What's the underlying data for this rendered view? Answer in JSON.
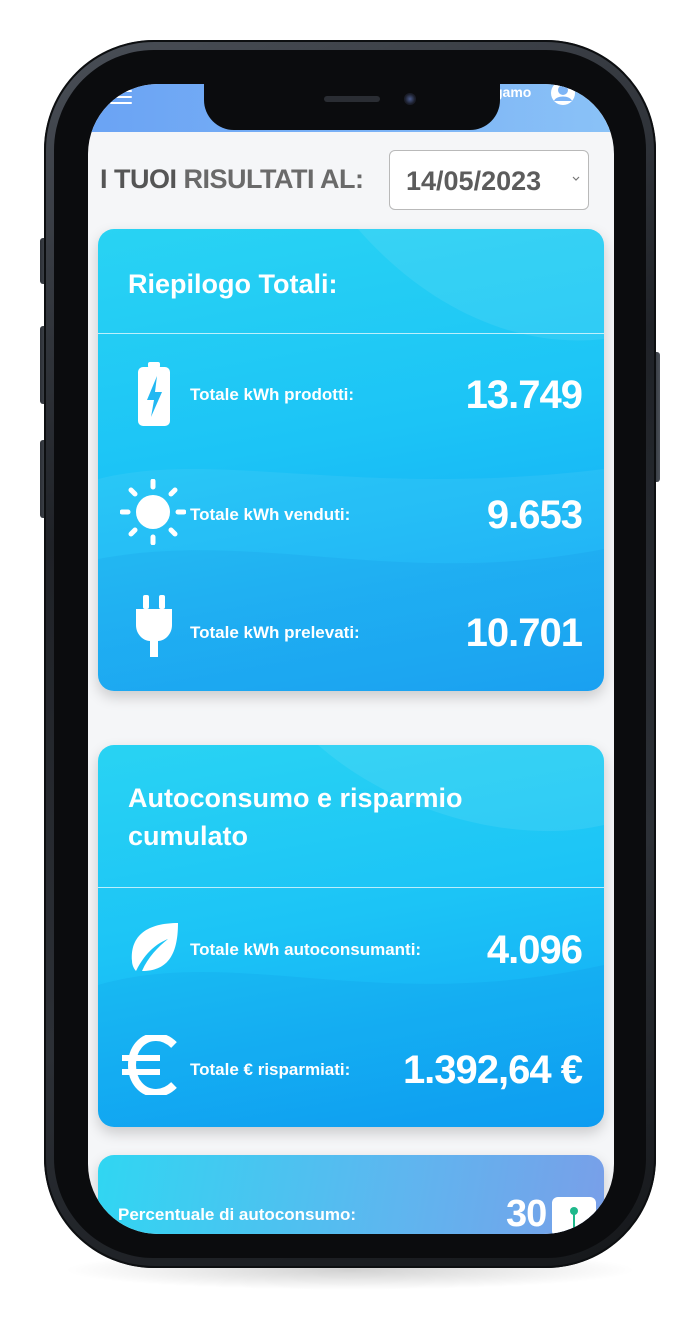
{
  "header": {
    "user_text": "gamo"
  },
  "results": {
    "title_part1": "I TUOI",
    "title_part2": "RISULTATI AL:",
    "date_value": "14/05/2023"
  },
  "summary_card": {
    "title": "Riepilogo Totali:",
    "rows": [
      {
        "icon": "battery-icon",
        "label": "Totale kWh prodotti:",
        "value": "13.749"
      },
      {
        "icon": "sun-icon",
        "label": "Totale kWh venduti:",
        "value": "9.653"
      },
      {
        "icon": "plug-icon",
        "label": "Totale kWh prelevati:",
        "value": "10.701"
      }
    ]
  },
  "selfconsumption_card": {
    "title_line1": "Autoconsumo e risparmio",
    "title_line2": "cumulato",
    "rows": [
      {
        "icon": "leaf-icon",
        "label": "Totale kWh autoconsumanti:",
        "value": "4.096"
      },
      {
        "icon": "euro-icon",
        "label": "Totale € risparmiati:",
        "value": "1.392,64 €"
      }
    ]
  },
  "percentage_card": {
    "label": "Percentuale di autoconsumo:",
    "value": "30"
  },
  "colors": {
    "card_gradient_start": "#29d3f3",
    "card_gradient_end": "#0fa2f5",
    "header_gradient": "#7db4f6",
    "text_primary": "#5c5c5c"
  }
}
